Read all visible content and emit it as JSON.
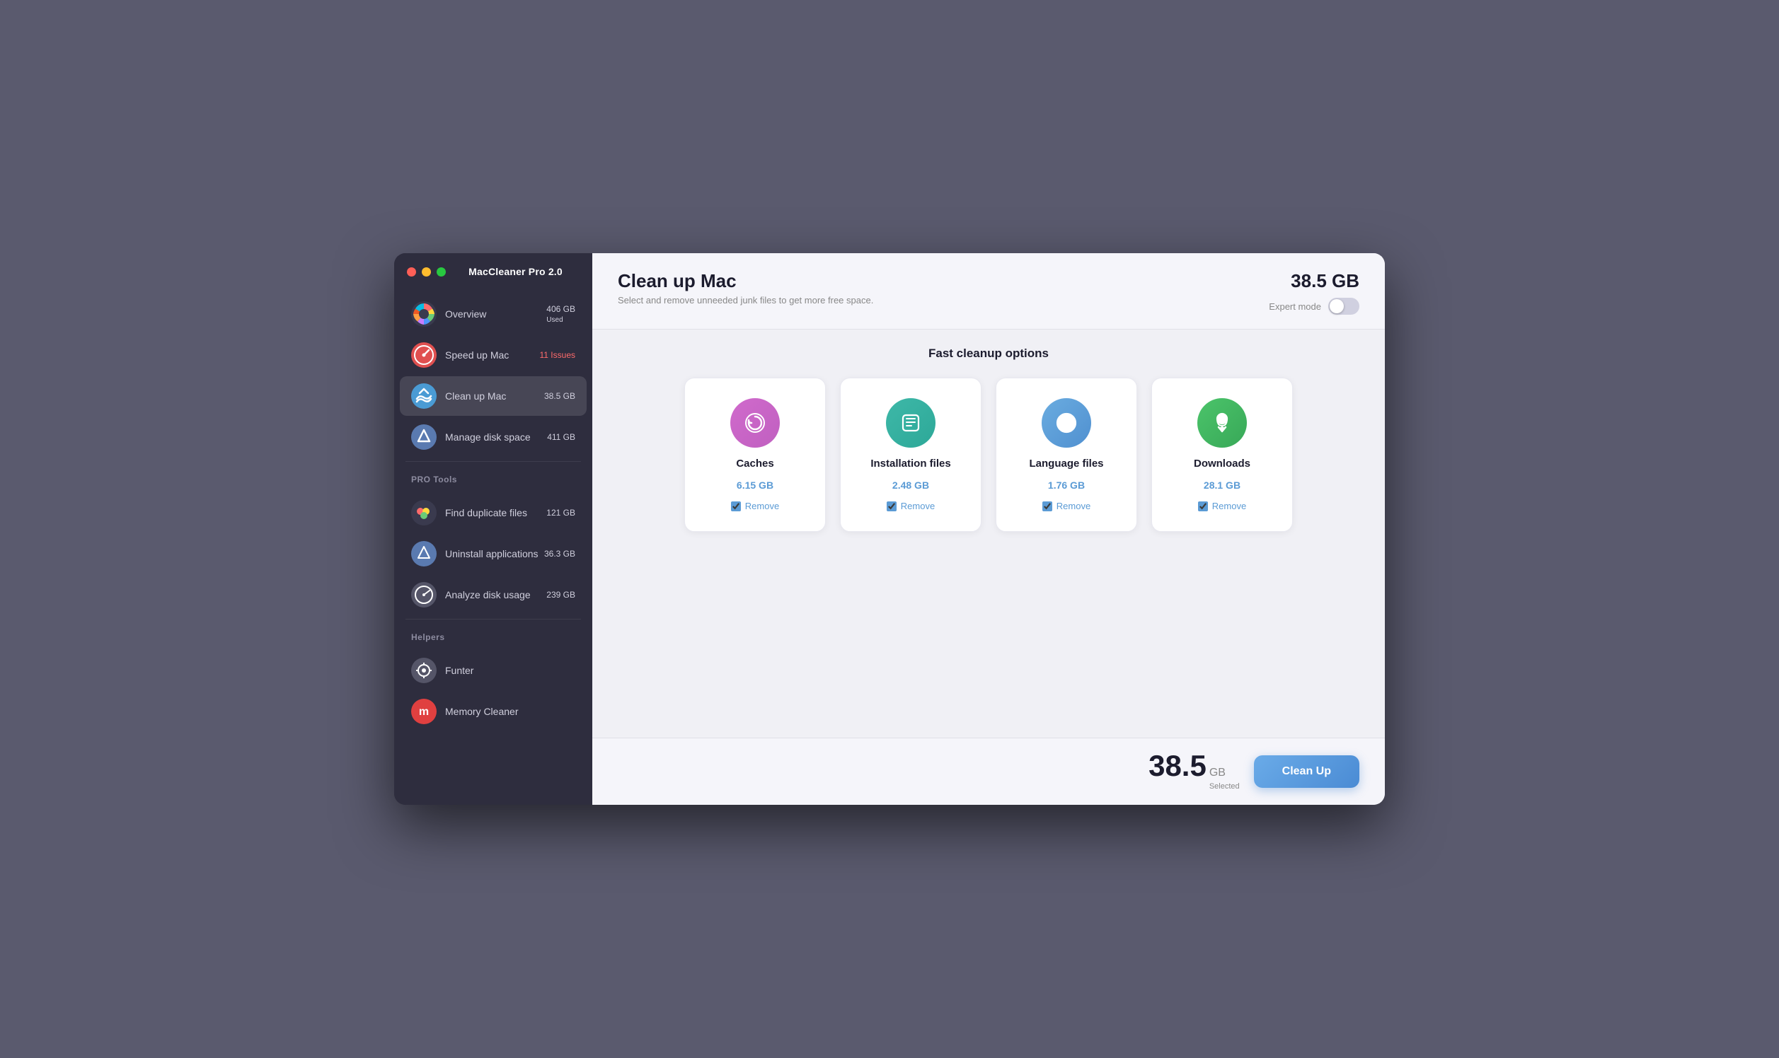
{
  "app": {
    "title": "MacCleaner Pro 2.0"
  },
  "sidebar": {
    "main_items": [
      {
        "id": "overview",
        "label": "Overview",
        "badge": "406 GB Used",
        "badge_color": "white",
        "icon_type": "overview"
      },
      {
        "id": "speedup",
        "label": "Speed up Mac",
        "badge": "11 Issues",
        "badge_color": "red",
        "icon_type": "speedup"
      },
      {
        "id": "cleanup",
        "label": "Clean up Mac",
        "badge": "38.5 GB",
        "badge_color": "white",
        "icon_type": "cleanup",
        "active": true
      },
      {
        "id": "disk",
        "label": "Manage disk space",
        "badge": "411 GB",
        "badge_color": "white",
        "icon_type": "disk"
      }
    ],
    "pro_label": "PRO Tools",
    "pro_items": [
      {
        "id": "duplicates",
        "label": "Find duplicate files",
        "badge": "121 GB"
      },
      {
        "id": "uninstall",
        "label": "Uninstall applications",
        "badge": "36.3 GB"
      },
      {
        "id": "analyze",
        "label": "Analyze disk usage",
        "badge": "239 GB"
      }
    ],
    "helpers_label": "Helpers",
    "helper_items": [
      {
        "id": "funter",
        "label": "Funter"
      },
      {
        "id": "memory",
        "label": "Memory Cleaner"
      }
    ]
  },
  "main": {
    "title": "Clean up Mac",
    "subtitle": "Select and remove unneeded junk files to get more free space.",
    "total_size": "38.5 GB",
    "expert_mode_label": "Expert mode",
    "section_title": "Fast cleanup options",
    "cards": [
      {
        "id": "caches",
        "name": "Caches",
        "size": "6.15 GB",
        "icon": "caches",
        "remove_label": "Remove",
        "checked": true
      },
      {
        "id": "installation",
        "name": "Installation files",
        "size": "2.48 GB",
        "icon": "install",
        "remove_label": "Remove",
        "checked": true
      },
      {
        "id": "language",
        "name": "Language files",
        "size": "1.76 GB",
        "icon": "language",
        "remove_label": "Remove",
        "checked": true
      },
      {
        "id": "downloads",
        "name": "Downloads",
        "size": "28.1 GB",
        "icon": "downloads",
        "remove_label": "Remove",
        "checked": true
      }
    ],
    "footer": {
      "size_number": "38.5",
      "size_unit": "GB",
      "size_label": "Selected",
      "cleanup_button": "Clean Up"
    }
  }
}
